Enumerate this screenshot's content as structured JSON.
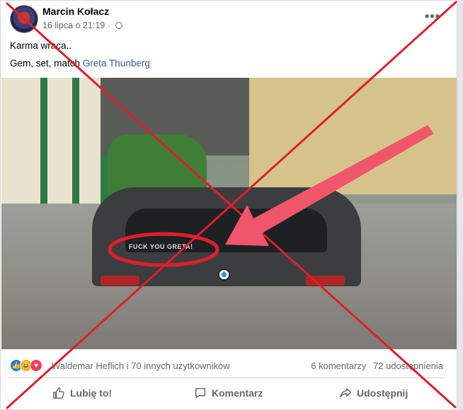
{
  "post": {
    "author": "Marcin Kołacz",
    "timestamp": "16 lipca o 21:19 ·",
    "text_line1": "Karma wraca..",
    "text_line2_prefix": "Gem, set, match ",
    "text_line2_tag": "Greta Thunberg"
  },
  "image": {
    "sticker_text": "FUCK YOU GRETA!"
  },
  "footer": {
    "likers": "Waldemar Heflich i 70 innych użytkowników",
    "comments": "6 komentarzy",
    "shares": "72 udostępnienia",
    "like_label": "Lubię to!",
    "comment_label": "Komentarz",
    "share_label": "Udostępnij"
  },
  "icons": [
    "avatar",
    "globe-icon",
    "more-options-icon",
    "like-reaction-icon",
    "haha-reaction-icon",
    "love-reaction-icon",
    "thumbs-up-icon",
    "comment-icon",
    "share-icon",
    "red-x-overlay",
    "red-arrow-overlay"
  ],
  "colors": {
    "overlay_red": "#e01e2b",
    "link_blue": "#385898",
    "secondary_text": "#65676b"
  }
}
